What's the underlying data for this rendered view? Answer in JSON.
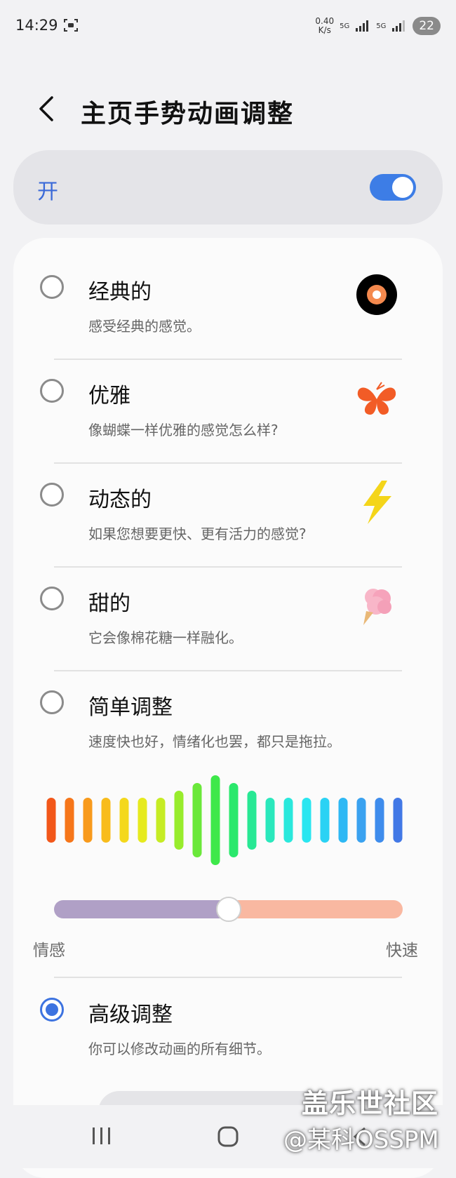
{
  "status_bar": {
    "time": "14:29",
    "net_speed_value": "0.40",
    "net_speed_unit": "K/s",
    "network_1": "5G",
    "network_2": "5G",
    "battery": "22"
  },
  "header": {
    "title": "主页手势动画调整"
  },
  "master_switch": {
    "label": "开",
    "state": "on",
    "accent_color": "#3d7de6"
  },
  "options": [
    {
      "title": "经典的",
      "description": "感受经典的感觉。",
      "icon": "vinyl-record-icon",
      "selected": false
    },
    {
      "title": "优雅",
      "description": "像蝴蝶一样优雅的感觉怎么样?",
      "icon": "butterfly-icon",
      "selected": false
    },
    {
      "title": "动态的",
      "description": "如果您想要更快、更有活力的感觉?",
      "icon": "lightning-bolt-icon",
      "selected": false
    },
    {
      "title": "甜的",
      "description": "它会像棉花糖一样融化。",
      "icon": "cotton-candy-icon",
      "selected": false
    },
    {
      "title": "简单调整",
      "description": "速度快也好，情绪化也罢，都只是拖拉。",
      "icon": "",
      "selected": false
    },
    {
      "title": "高级调整",
      "description": "你可以修改动画的所有细节。",
      "icon": "",
      "selected": true
    }
  ],
  "simple_adjust": {
    "slider_value": 0.5,
    "label_left": "情感",
    "label_right": "快速",
    "left_color": "#b0a0c6",
    "right_color": "#f9b8a1"
  },
  "watermark": {
    "line1": "盖乐世社区",
    "line2": "@某科OSSPM"
  },
  "nav_bar": {
    "recent": "recent-apps-icon",
    "home": "home-icon",
    "back": "back-icon"
  }
}
